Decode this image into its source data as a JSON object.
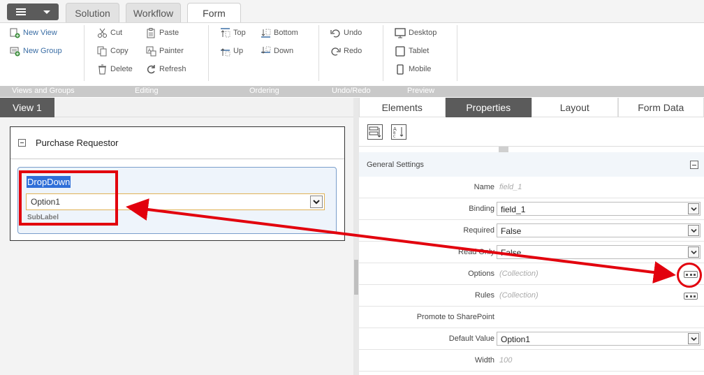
{
  "tabs": {
    "solution": "Solution",
    "workflow": "Workflow",
    "form": "Form"
  },
  "ribbon": {
    "views": {
      "new_view": "New View",
      "new_group": "New Group"
    },
    "editing": {
      "cut": "Cut",
      "copy": "Copy",
      "delete": "Delete",
      "paste": "Paste",
      "painter": "Painter",
      "refresh": "Refresh"
    },
    "ordering": {
      "top": "Top",
      "up": "Up",
      "bottom": "Bottom",
      "down": "Down"
    },
    "undo": {
      "undo": "Undo",
      "redo": "Redo"
    },
    "preview": {
      "desktop": "Desktop",
      "tablet": "Tablet",
      "mobile": "Mobile"
    },
    "groups": [
      "Views and Groups",
      "Editing",
      "Ordering",
      "Undo/Redo",
      "Preview"
    ]
  },
  "canvas": {
    "view_tab": "View 1",
    "section_title": "Purchase Requestor",
    "control_label": "DropDown",
    "control_value": "Option1",
    "control_sublabel": "SubLabel"
  },
  "panel": {
    "tabs": [
      "Elements",
      "Properties",
      "Layout",
      "Form Data"
    ],
    "section": "General Settings",
    "props": {
      "name": {
        "label": "Name",
        "value": "field_1"
      },
      "binding": {
        "label": "Binding",
        "value": "field_1"
      },
      "required": {
        "label": "Required",
        "value": "False"
      },
      "readonly": {
        "label": "Read Only",
        "value": "False"
      },
      "options": {
        "label": "Options",
        "value": "(Collection)"
      },
      "rules": {
        "label": "Rules",
        "value": "(Collection)"
      },
      "promote": {
        "label": "Promote to SharePoint",
        "value": ""
      },
      "default": {
        "label": "Default Value",
        "value": "Option1"
      },
      "width": {
        "label": "Width",
        "value": "100"
      }
    }
  },
  "colors": {
    "annotation": "#e2000d",
    "dark_tab": "#5b5b5b",
    "link": "#3b6ea5"
  }
}
